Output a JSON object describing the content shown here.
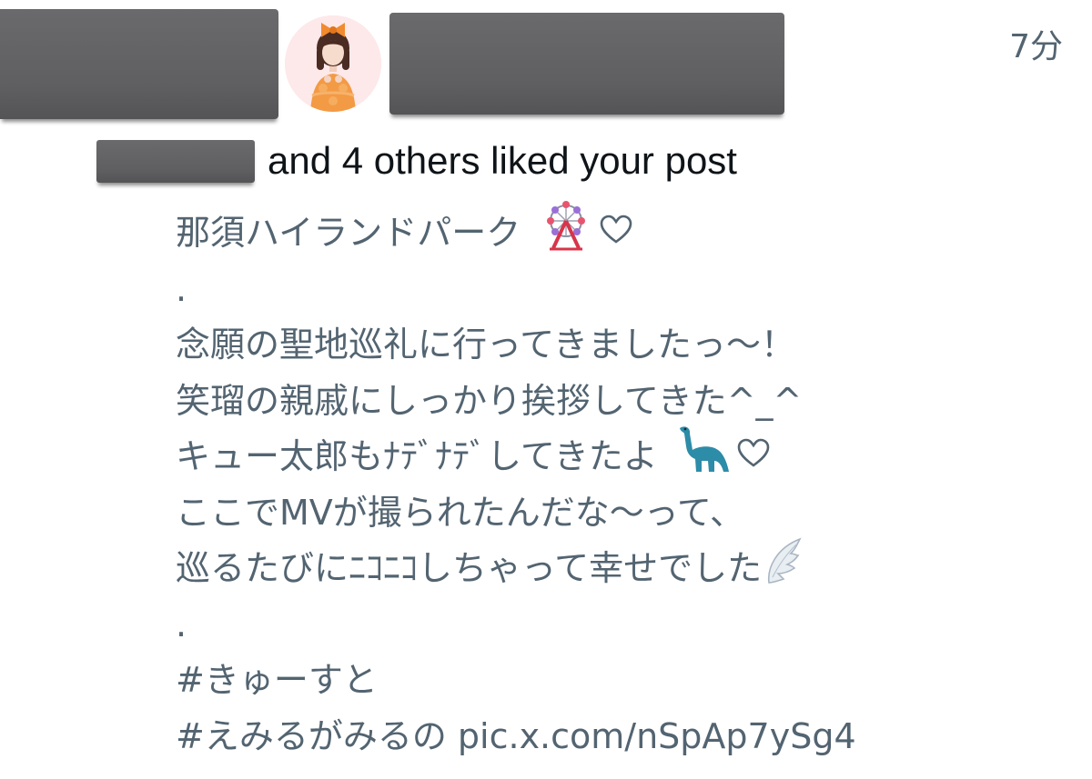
{
  "notification": {
    "timestamp": "7分",
    "summary": "and 4 others liked your post",
    "avatar_icon": "profile-avatar"
  },
  "post": {
    "lines": [
      "那須ハイランドパーク",
      ".",
      "念願の聖地巡礼に行ってきましたっ〜！",
      "笑瑠の親戚にしっかり挨拶してきた^_^",
      "キュー太郎もﾅﾃﾞﾅﾃﾞしてきたよ",
      "ここでMVが撮られたんだな〜って、",
      "巡るたびにﾆｺﾆｺしちゃって幸せでした",
      ".",
      "#きゅーすと",
      "#えみるがみるの pic.x.com/nSpAp7ySg4"
    ],
    "emoji": {
      "line0": [
        "ferris-wheel-icon",
        "heart-outline-icon"
      ],
      "line4": [
        "dinosaur-icon",
        "heart-outline-icon"
      ],
      "line6": [
        "wing-icon"
      ]
    }
  },
  "colors": {
    "primary_text": "#0f1419",
    "secondary_text": "#536471",
    "redaction": "#5f5f61"
  }
}
